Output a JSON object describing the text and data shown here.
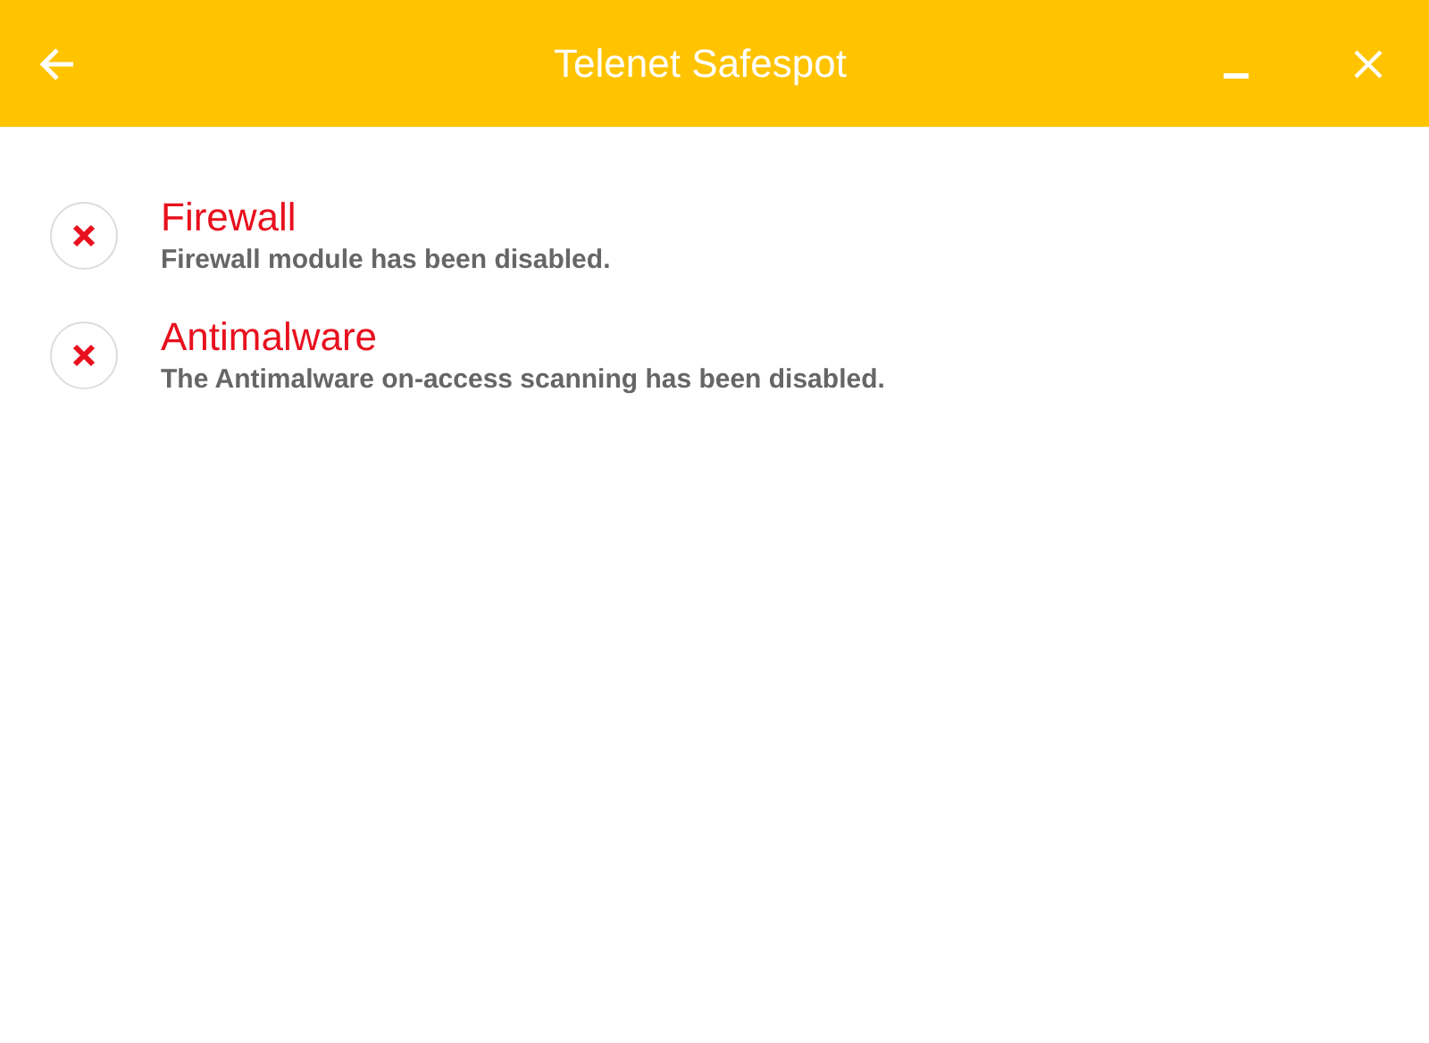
{
  "window": {
    "title": "Telenet Safespot"
  },
  "modules": [
    {
      "name": "Firewall",
      "message": "Firewall module has been disabled.",
      "disabled": true
    },
    {
      "name": "Antimalware",
      "message": "The Antimalware on-access scanning has been disabled.",
      "disabled": true
    }
  ]
}
